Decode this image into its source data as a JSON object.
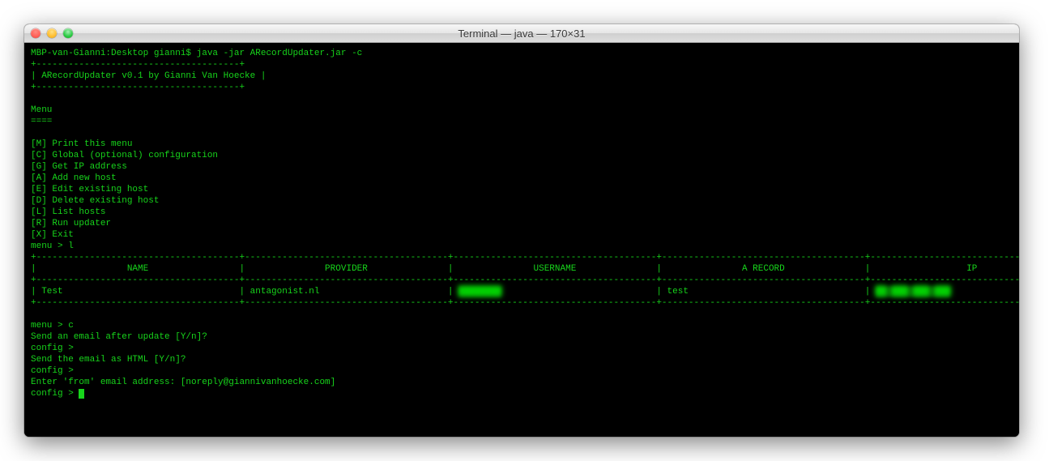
{
  "window": {
    "title": "Terminal — java — 170×31"
  },
  "colors": {
    "fg": "#17d41b",
    "bg": "#000000"
  },
  "session": {
    "prompt_line": "MBP-van-Gianni:Desktop gianni$ java -jar ARecordUpdater.jar -c",
    "box_border": "+--------------------------------------+",
    "box_title": "| ARecordUpdater v0.1 by Gianni Van Hoecke |",
    "menu_header": "Menu",
    "menu_underline": "====",
    "menu_items": [
      "[M] Print this menu",
      "[C] Global (optional) configuration",
      "[G] Get IP address",
      "[A] Add new host",
      "[E] Edit existing host",
      "[D] Delete existing host",
      "[L] List hosts",
      "[R] Run updater",
      "[X] Exit"
    ],
    "prompt_menu_l": "menu > l",
    "table": {
      "border": "+--------------------------------------+--------------------------------------+--------------------------------------+--------------------------------------+--------------------------------------+",
      "header": "|                 NAME                 |               PROVIDER               |               USERNAME               |               A RECORD               |                  IP                  |",
      "row_prefix": "| Test                                 | antagonist.nl                        | ",
      "row_user_redacted": "████████",
      "row_mid": "                             | test                                 | ",
      "row_ip_redacted": "██.███.███.███",
      "row_suffix": "                       |",
      "columns": [
        "NAME",
        "PROVIDER",
        "USERNAME",
        "A RECORD",
        "IP"
      ],
      "rows": [
        {
          "name": "Test",
          "provider": "antagonist.nl",
          "username": "[redacted]",
          "a_record": "test",
          "ip": "[redacted]"
        }
      ]
    },
    "prompt_menu_c": "menu > c",
    "cfg1_q": "Send an email after update [Y/n]?",
    "cfg1_p": "config >",
    "cfg2_q": "Send the email as HTML [Y/n]?",
    "cfg2_p": "config >",
    "cfg3_q": "Enter 'from' email address: [noreply@giannivanhoecke.com]",
    "cfg3_p": "config > "
  }
}
